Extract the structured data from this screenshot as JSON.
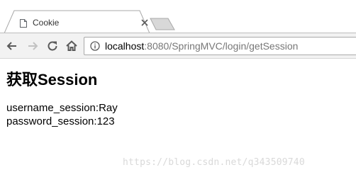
{
  "tab": {
    "title": "Cookie",
    "favicon": "page-icon",
    "close_icon": "close-icon"
  },
  "toolbar": {
    "back_icon": "back-arrow-icon",
    "forward_icon": "forward-arrow-icon",
    "reload_icon": "reload-icon",
    "home_icon": "home-icon",
    "info_icon": "info-icon",
    "url_host": "localhost",
    "url_rest": ":8080/SpringMVC/login/getSession"
  },
  "page": {
    "heading": "获取Session",
    "lines": [
      "username_session:Ray",
      "password_session:123"
    ]
  },
  "watermark": "https://blog.csdn.net/q343509740",
  "colors": {
    "toolbar_bg": "#f2f2f2",
    "tab_bg": "#ffffff",
    "url_host": "#000000",
    "url_rest": "#777777"
  }
}
